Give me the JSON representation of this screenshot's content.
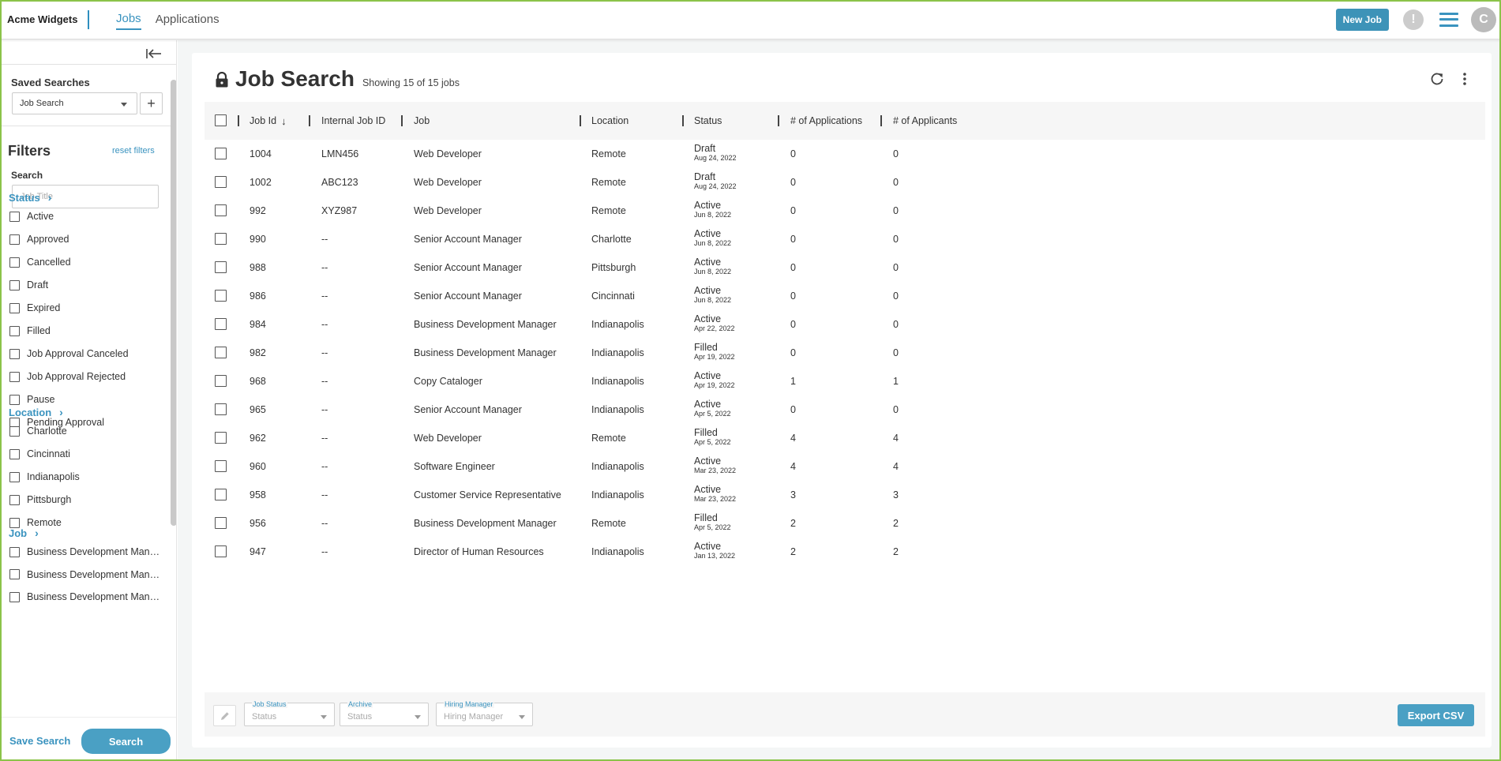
{
  "app": {
    "brand": "Acme Widgets",
    "nav_tabs": [
      "Jobs",
      "Applications"
    ],
    "new_job_label": "New Job",
    "avatar_initial": "C",
    "accent_color": "#3a93bf"
  },
  "sidebar": {
    "saved_searches_title": "Saved Searches",
    "saved_search_value": "Job Search",
    "filters_title": "Filters",
    "reset_filters": "reset filters",
    "search_label": "Search",
    "search_placeholder": "Job Title",
    "status_head": "Status",
    "status_items": [
      "Active",
      "Approved",
      "Cancelled",
      "Draft",
      "Expired",
      "Filled",
      "Job Approval Canceled",
      "Job Approval Rejected",
      "Pause",
      "Pending Approval"
    ],
    "location_head": "Location",
    "location_items": [
      "Charlotte",
      "Cincinnati",
      "Indianapolis",
      "Pittsburgh",
      "Remote"
    ],
    "job_head": "Job",
    "job_items": [
      "Business Development Manager",
      "Business Development Manager",
      "Business Development Manager"
    ],
    "save_search_label": "Save Search",
    "search_button_label": "Search"
  },
  "main": {
    "title": "Job Search",
    "subtitle": "Showing 15 of 15 jobs",
    "columns": [
      "Job Id",
      "Internal Job ID",
      "Job",
      "Location",
      "Status",
      "# of Applications",
      "# of Applicants"
    ],
    "rows": [
      {
        "id": "1004",
        "internal": "LMN456",
        "job": "Web Developer",
        "location": "Remote",
        "status": "Draft",
        "date": "Aug 24, 2022",
        "applications": "0",
        "applicants": "0"
      },
      {
        "id": "1002",
        "internal": "ABC123",
        "job": "Web Developer",
        "location": "Remote",
        "status": "Draft",
        "date": "Aug 24, 2022",
        "applications": "0",
        "applicants": "0"
      },
      {
        "id": "992",
        "internal": "XYZ987",
        "job": "Web Developer",
        "location": "Remote",
        "status": "Active",
        "date": "Jun 8, 2022",
        "applications": "0",
        "applicants": "0"
      },
      {
        "id": "990",
        "internal": "--",
        "job": "Senior Account Manager",
        "location": "Charlotte",
        "status": "Active",
        "date": "Jun 8, 2022",
        "applications": "0",
        "applicants": "0"
      },
      {
        "id": "988",
        "internal": "--",
        "job": "Senior Account Manager",
        "location": "Pittsburgh",
        "status": "Active",
        "date": "Jun 8, 2022",
        "applications": "0",
        "applicants": "0"
      },
      {
        "id": "986",
        "internal": "--",
        "job": "Senior Account Manager",
        "location": "Cincinnati",
        "status": "Active",
        "date": "Jun 8, 2022",
        "applications": "0",
        "applicants": "0"
      },
      {
        "id": "984",
        "internal": "--",
        "job": "Business Development Manager",
        "location": "Indianapolis",
        "status": "Active",
        "date": "Apr 22, 2022",
        "applications": "0",
        "applicants": "0"
      },
      {
        "id": "982",
        "internal": "--",
        "job": "Business Development Manager",
        "location": "Indianapolis",
        "status": "Filled",
        "date": "Apr 19, 2022",
        "applications": "0",
        "applicants": "0"
      },
      {
        "id": "968",
        "internal": "--",
        "job": "Copy Cataloger",
        "location": "Indianapolis",
        "status": "Active",
        "date": "Apr 19, 2022",
        "applications": "1",
        "applicants": "1"
      },
      {
        "id": "965",
        "internal": "--",
        "job": "Senior Account Manager",
        "location": "Indianapolis",
        "status": "Active",
        "date": "Apr 5, 2022",
        "applications": "0",
        "applicants": "0"
      },
      {
        "id": "962",
        "internal": "--",
        "job": "Web Developer",
        "location": "Remote",
        "status": "Filled",
        "date": "Apr 5, 2022",
        "applications": "4",
        "applicants": "4"
      },
      {
        "id": "960",
        "internal": "--",
        "job": "Software Engineer",
        "location": "Indianapolis",
        "status": "Active",
        "date": "Mar 23, 2022",
        "applications": "4",
        "applicants": "4"
      },
      {
        "id": "958",
        "internal": "--",
        "job": "Customer Service Representative",
        "location": "Indianapolis",
        "status": "Active",
        "date": "Mar 23, 2022",
        "applications": "3",
        "applicants": "3"
      },
      {
        "id": "956",
        "internal": "--",
        "job": "Business Development Manager",
        "location": "Remote",
        "status": "Filled",
        "date": "Apr 5, 2022",
        "applications": "2",
        "applicants": "2"
      },
      {
        "id": "947",
        "internal": "--",
        "job": "Director of Human Resources",
        "location": "Indianapolis",
        "status": "Active",
        "date": "Jan 13, 2022",
        "applications": "2",
        "applicants": "2"
      }
    ]
  },
  "footer": {
    "job_status_label": "Job Status",
    "job_status_value": "Status",
    "archive_label": "Archive",
    "archive_value": "Status",
    "hiring_manager_label": "Hiring Manager",
    "hiring_manager_value": "Hiring Manager",
    "export_label": "Export CSV"
  }
}
